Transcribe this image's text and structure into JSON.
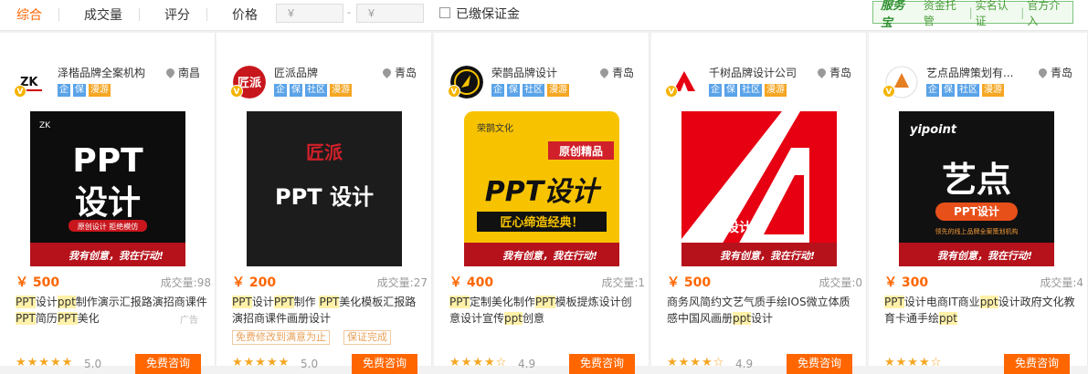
{
  "sort": {
    "items": [
      "综合",
      "成交量",
      "评分",
      "价格"
    ]
  },
  "price_filter": {
    "min_placeholder": "￥",
    "max_placeholder": "￥",
    "dash": "-"
  },
  "deposit_filter": {
    "label": "已缴保证金"
  },
  "service_bar": {
    "logo": "服务宝",
    "items": [
      "资金托管",
      "实名认证",
      "官方介入"
    ]
  },
  "products": [
    {
      "shop": "泽楷品牌全案机构",
      "location": "南昌",
      "tags": [
        "企",
        "保",
        "漫游"
      ],
      "price": "￥ 500",
      "deals": "成交量:98",
      "title": [
        "PPT",
        "设计",
        "ppt",
        "制作演示汇报路演招商课件",
        "PPT",
        "简历",
        "PPT",
        "美化"
      ],
      "ad": "广告",
      "promo": [],
      "stars": "★★★★★",
      "rating": "5.0",
      "button": "免费咨询",
      "thumb": {
        "bg": "#0d0d0d",
        "logo": "ZK",
        "line1": "PPT",
        "line2": "设计",
        "sub": "原创设计 拒绝模仿",
        "slogan": "我有创意，我在行动!"
      }
    },
    {
      "shop": "匠派品牌",
      "location": "青岛",
      "tags": [
        "企",
        "保",
        "社区",
        "漫游"
      ],
      "price": "￥ 200",
      "deals": "成交量:27",
      "title": [
        "PPT",
        "设计",
        "PPT",
        "制作 ",
        "PPT",
        "美化模板汇报路演招商课件画册设计"
      ],
      "ad": "",
      "promo": [
        "免费修改到满意为止",
        "保证完成"
      ],
      "stars": "★★★★★",
      "rating": "5.0",
      "button": "免费咨询",
      "thumb": {
        "bg": "#1c1c1c",
        "logo": "匠派",
        "line1": "PPT 设计"
      }
    },
    {
      "shop": "荣鹊品牌设计",
      "location": "青岛",
      "tags": [
        "企",
        "保",
        "社区",
        "漫游"
      ],
      "price": "￥ 400",
      "deals": "成交量:1",
      "title": [
        "PPT",
        "定制美化制作",
        "PPT",
        "模板提炼设计创意设计宣传",
        "ppt",
        "创意"
      ],
      "ad": "",
      "promo": [],
      "stars": "★★★★☆",
      "rating": "4.9",
      "button": "免费咨询",
      "thumb": {
        "bg": "#f7c300",
        "logo": "荣鹊文化",
        "badge": "原创精品",
        "line1": "PPT设计",
        "sub": "匠心缔造经典！",
        "slogan": "我有创意，我在行动!"
      }
    },
    {
      "shop": "千树品牌设计公司",
      "location": "青岛",
      "tags": [
        "企",
        "保",
        "社区",
        "漫游"
      ],
      "price": "￥ 500",
      "deals": "成交量:0",
      "title": [
        "商务风简约文艺气质手绘IOS微立体质感中国风画册",
        "ppt",
        "设计"
      ],
      "ad": "",
      "promo": [],
      "stars": "★★★★☆",
      "rating": "4.9",
      "button": "免费咨询",
      "thumb": {
        "bg": "#e60012",
        "line1": "PPT设计",
        "slogan": "我有创意，我在行动!"
      }
    },
    {
      "shop": "艺点品牌策划有...",
      "location": "青岛",
      "tags": [
        "企",
        "保",
        "社区",
        "漫游"
      ],
      "price": "￥ 300",
      "deals": "成交量:4",
      "title": [
        "PPT",
        "设计电商IT商业",
        "ppt",
        "设计政府文化教育卡通手绘",
        "ppt"
      ],
      "ad": "",
      "promo": [],
      "stars": "★★★★☆",
      "rating": "",
      "button": "免费咨询",
      "thumb": {
        "bg": "#111",
        "logo": "yipoint",
        "line1": "艺点",
        "line2": "PPT设计",
        "sub": "领先的线上品牌全案策划机构",
        "slogan": "我有创意，我在行动!"
      }
    }
  ],
  "colors": {
    "accent": "#ff6600",
    "tag_blue": "#5aa3e8",
    "tag_orange": "#f5a623",
    "service_green": "#4a9c3a"
  }
}
